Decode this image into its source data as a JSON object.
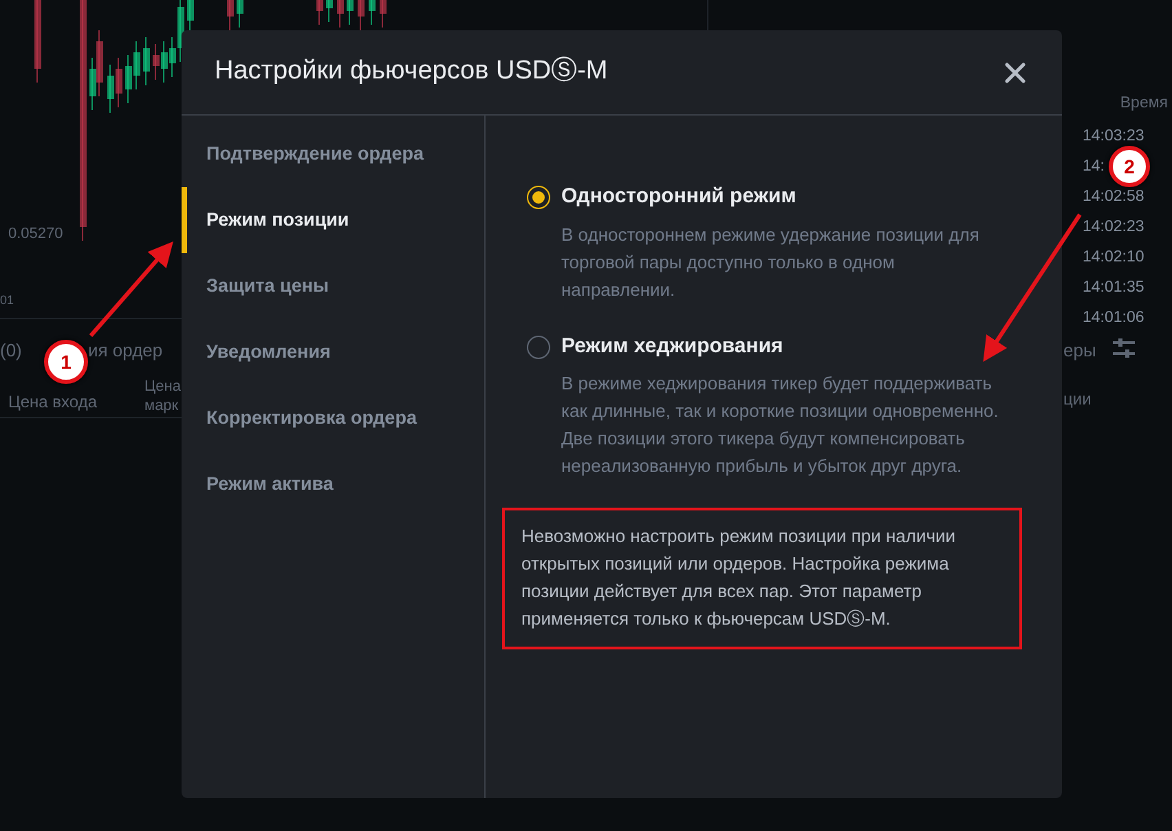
{
  "background": {
    "price_label": "0.05270",
    "axis_label": "01",
    "tab_count": "(0)",
    "tab_label": "ия ордер",
    "columns": [
      "Цена входа",
      "Цена\nмарк"
    ],
    "right_tab": "еры",
    "right_column": "ции",
    "trades_header": "Время",
    "times": [
      "14:03:23",
      "14:",
      "14:02:58",
      "14:02:23",
      "14:02:10",
      "14:01:35",
      "14:01:06"
    ]
  },
  "modal": {
    "title": "Настройки фьючерсов USDⓈ-M",
    "sidebar": [
      {
        "label": "Подтверждение ордера",
        "selected": false
      },
      {
        "label": "Режим позиции",
        "selected": true
      },
      {
        "label": "Защита цены",
        "selected": false
      },
      {
        "label": "Уведомления",
        "selected": false
      },
      {
        "label": "Корректировка ордера",
        "selected": false
      },
      {
        "label": "Режим актива",
        "selected": false
      }
    ],
    "options": [
      {
        "title": "Односторонний режим",
        "description": "В одностороннем режиме удержание позиции для торговой пары доступно только в одном направлении.",
        "selected": true
      },
      {
        "title": "Режим хеджирования",
        "description": "В режиме хеджирования тикер будет поддерживать как длинные, так и короткие позиции одновременно. Две позиции этого тикера будут компенсировать нереализованную прибыль и убыток друг друга.",
        "selected": false
      }
    ],
    "notice": "Невозможно настроить режим позиции при наличии открытых позиций или ордеров. Настройка режима позиции действует для всех пар. Этот параметр применяется только к фьючерсам USDⓈ-M."
  },
  "annotations": [
    {
      "label": "1"
    },
    {
      "label": "2"
    }
  ]
}
